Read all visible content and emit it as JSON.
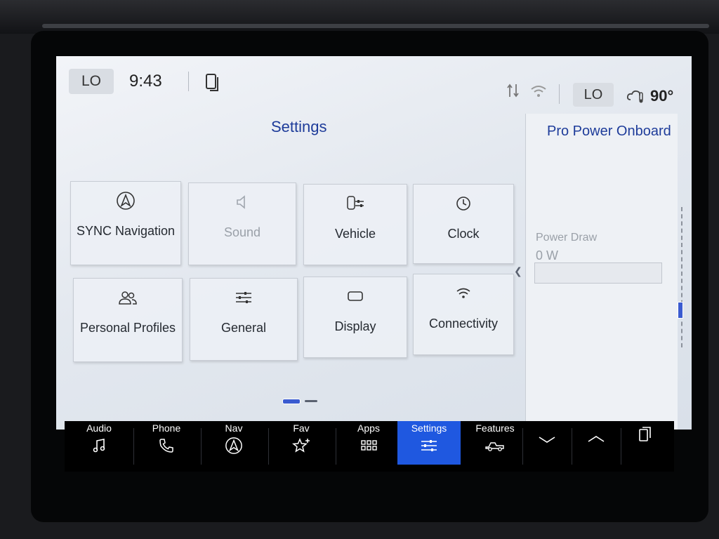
{
  "status_bar": {
    "climate_left": "LO",
    "time": "9:43",
    "climate_right": "LO",
    "temperature": "90°",
    "icons": [
      "phone-projection-icon",
      "signal-icon",
      "wifi-icon",
      "weather-cloudy-icon"
    ]
  },
  "settings": {
    "title": "Settings",
    "tiles": [
      {
        "label": "SYNC Navigation",
        "icon": "navigation-arrow-icon",
        "enabled": true
      },
      {
        "label": "Sound",
        "icon": "speaker-icon",
        "enabled": false
      },
      {
        "label": "Vehicle",
        "icon": "vehicle-settings-icon",
        "enabled": true
      },
      {
        "label": "Clock",
        "icon": "clock-icon",
        "enabled": true
      },
      {
        "label": "Personal Profiles",
        "icon": "profiles-icon",
        "enabled": true
      },
      {
        "label": "General",
        "icon": "sliders-icon",
        "enabled": true
      },
      {
        "label": "Display",
        "icon": "display-icon",
        "enabled": true
      },
      {
        "label": "Connectivity",
        "icon": "wifi-icon",
        "enabled": true
      }
    ],
    "page_count": 2,
    "current_page": 1
  },
  "pro_power": {
    "title": "Pro Power Onboard",
    "power_draw_label": "Power Draw",
    "power_draw_value": "0 W",
    "power_draw_fraction": 0
  },
  "nav": {
    "items": [
      {
        "label": "Audio",
        "icon": "music-note-icon",
        "active": false
      },
      {
        "label": "Phone",
        "icon": "phone-icon",
        "active": false
      },
      {
        "label": "Nav",
        "icon": "navigation-arrow-icon",
        "active": false
      },
      {
        "label": "Fav",
        "icon": "star-add-icon",
        "active": false
      },
      {
        "label": "Apps",
        "icon": "apps-grid-icon",
        "active": false
      },
      {
        "label": "Settings",
        "icon": "sliders-icon",
        "active": true
      },
      {
        "label": "Features",
        "icon": "truck-icon",
        "active": false
      }
    ],
    "extra_icons": [
      "chevron-down-icon",
      "chevron-up-icon",
      "phone-projection-icon"
    ]
  },
  "colors": {
    "accent": "#1f58e0",
    "title_blue": "#1e3c9a"
  }
}
